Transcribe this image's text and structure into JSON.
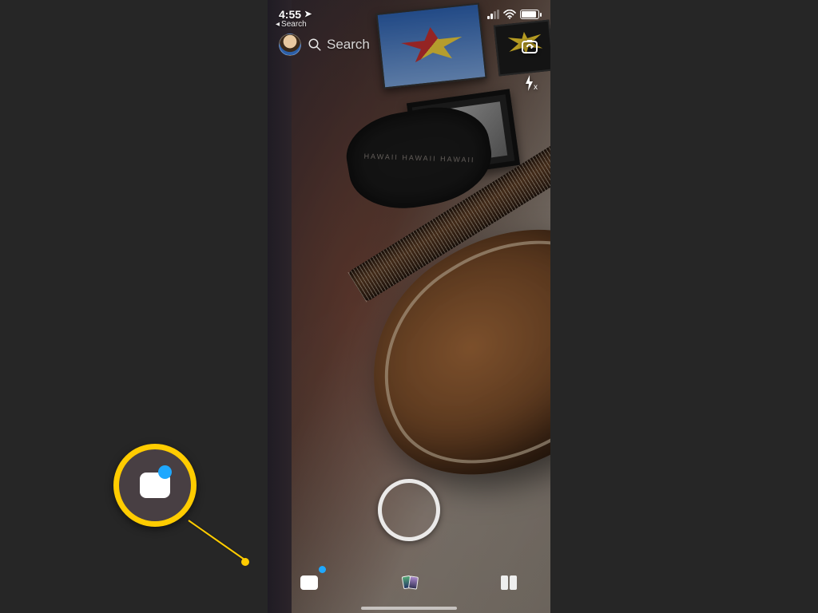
{
  "statusbar": {
    "time": "4:55",
    "location_arrow": "➤",
    "back_label": "Search",
    "wifi_label": "wifi",
    "signal_label": "cell-signal",
    "battery_label": "battery"
  },
  "topbar": {
    "search_placeholder": "Search",
    "avatar_label": "profile-bitmoji",
    "flip_label": "flip-camera",
    "flash_label": "flash-off"
  },
  "capture": {
    "label": "capture"
  },
  "bottomnav": {
    "chat": {
      "label": "chat",
      "has_notification": true
    },
    "memories": {
      "label": "memories"
    },
    "discover": {
      "label": "discover"
    }
  },
  "annotation": {
    "highlight_target": "chat-tab",
    "color": "#ffcc00"
  }
}
